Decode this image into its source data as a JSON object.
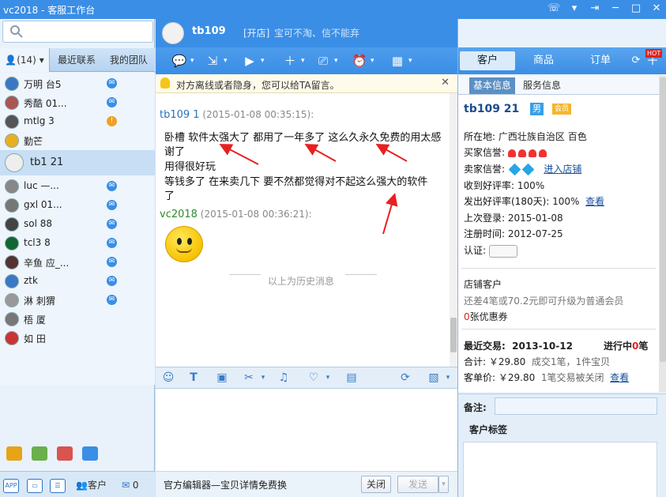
{
  "window": {
    "title": "vc2018 - 客服工作台",
    "controls": [
      "phone-icon",
      "chevron-down-icon",
      "pin-icon",
      "minimize-icon",
      "maximize-icon",
      "close-icon"
    ]
  },
  "left": {
    "search": {
      "placeholder": ""
    },
    "tabs": [
      {
        "label": "(14)"
      },
      {
        "label": "最近联系"
      },
      {
        "label": "我的团队"
      }
    ],
    "contacts": [
      {
        "name": "万明 台5",
        "badge": "msg"
      },
      {
        "name": "秀酷 01...",
        "badge": "msg"
      },
      {
        "name": "mtlg 3",
        "badge": "orange"
      },
      {
        "name": "勤芒",
        "badge": ""
      },
      {
        "name": "tb1 21",
        "badge": "",
        "selected": true
      },
      {
        "name": "luc —...",
        "badge": "msg"
      },
      {
        "name": "gxl 01...",
        "badge": "msg"
      },
      {
        "name": "sol 88",
        "badge": "msg"
      },
      {
        "name": "tcl3 8",
        "badge": "msg"
      },
      {
        "name": "辛鱼 应_...",
        "badge": "msg"
      },
      {
        "name": "ztk",
        "badge": "msg"
      },
      {
        "name": "淋 刺猬",
        "badge": "msg"
      },
      {
        "name": "梧 厦",
        "badge": ""
      },
      {
        "name": "如 田",
        "badge": ""
      }
    ],
    "bottom": {
      "app_label": "APP",
      "customer_label": "客户",
      "mail_count": "0"
    }
  },
  "chat": {
    "header": {
      "name": "tb109",
      "shop_tag": "[开店]",
      "motto": "宝可不淘、信不能弃"
    },
    "notice": "对方离线或者隐身，您可以给TA留言。",
    "messages": [
      {
        "who": "tb109 1",
        "time": "(2015-01-08 00:35:15):",
        "lines": [
          "卧槽 软件太强大了  都用了一年多了  这么久永久免费的用太感",
          "谢了",
          "用得很好玩",
          "等钱多了  在来卖几下 要不然都觉得对不起这么强大的软件",
          "了"
        ]
      },
      {
        "who": "vc2018",
        "time": "(2015-01-08 00:36:21):",
        "lines": []
      }
    ],
    "history_divider": "以上为历史消息",
    "input_bottom": {
      "promo": "官方编辑器—宝贝详情免费换",
      "close": "关闭",
      "send": "发送"
    }
  },
  "right": {
    "tabs": [
      {
        "label": "客户"
      },
      {
        "label": "商品"
      },
      {
        "label": "订单"
      }
    ],
    "hot": "HOT",
    "info_tabs": [
      {
        "label": "基本信息"
      },
      {
        "label": "服务信息"
      }
    ],
    "customer": {
      "name": "tb109 21",
      "gender": "男",
      "vip": "会员",
      "location_label": "所在地:",
      "location": "广西壮族自治区 百色",
      "buyer_credit_label": "买家信誉:",
      "seller_credit_label": "卖家信誉:",
      "enter_shop": "进入店铺",
      "good_rate_label": "收到好评率:",
      "good_rate": "100%",
      "sent_rate_label": "发出好评率(180天):",
      "sent_rate": "100%",
      "view": "查看",
      "last_login_label": "上次登录:",
      "last_login": "2015-01-08",
      "register_label": "注册时间:",
      "register": "2012-07-25",
      "cert_label": "认证:",
      "store_customer": "店铺客户",
      "upgrade_prefix": "还差",
      "upgrade_count": "4",
      "upgrade_mid1": "笔或",
      "upgrade_amount": "70.2",
      "upgrade_suffix": "元即可升级为普通会员",
      "coupon_count": "0",
      "coupon_label": "张优惠券",
      "last_trade_label": "最近交易:",
      "last_trade_date": "2013-10-12",
      "in_progress_label": "进行中",
      "in_progress_count": "0",
      "in_progress_unit": "笔",
      "total_label": "合计:",
      "total_amount": "￥29.80",
      "total_detail": "成交1笔，1件宝贝",
      "avg_label": "客单价:",
      "avg_amount": "￥29.80",
      "closed_detail": "1笔交易被关闭",
      "view2": "查看"
    },
    "remarks_label": "备注:",
    "tags_title": "客户标签",
    "colors": {
      "accent": "#3a8ee6",
      "price_red": "#e02020"
    }
  }
}
